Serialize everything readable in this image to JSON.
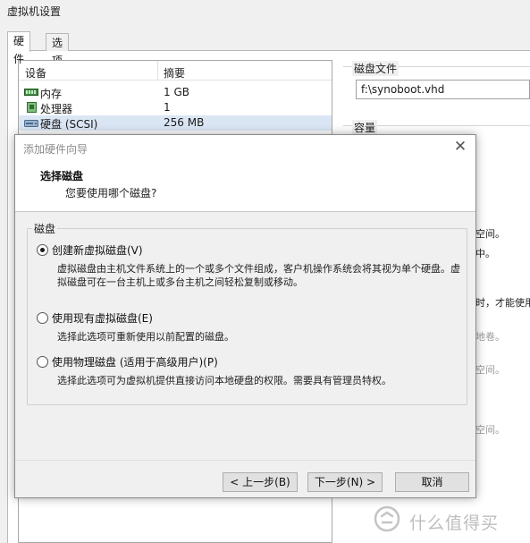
{
  "window": {
    "title": "虚拟机设置",
    "tabs": [
      {
        "label": "硬件",
        "active": true
      },
      {
        "label": "选项",
        "active": false
      }
    ]
  },
  "device_list": {
    "columns": [
      "设备",
      "摘要"
    ],
    "rows": [
      {
        "icon": "memory-icon",
        "name": "内存",
        "summary": "1 GB"
      },
      {
        "icon": "processor-icon",
        "name": "处理器",
        "summary": "1"
      },
      {
        "icon": "hard-disk-icon",
        "name": "硬盘 (SCSI)",
        "summary": "256 MB",
        "selected": true
      }
    ]
  },
  "right_pane": {
    "disk_file_label": "磁盘文件",
    "disk_file_value": "f:\\synoboot.vhd",
    "capacity_label": "容量",
    "fragments": [
      "空间。",
      "中。",
      "时，才能使用",
      "地卷。",
      "空间。",
      "空间。"
    ]
  },
  "dialog": {
    "title": "添加硬件向导",
    "heading": "选择磁盘",
    "subheading": "您要使用哪个磁盘?",
    "group_label": "磁盘",
    "options": [
      {
        "label": "创建新虚拟磁盘(V)",
        "checked": true,
        "description": "虚拟磁盘由主机文件系统上的一个或多个文件组成，客户机操作系统会将其视为单个硬盘。虚拟磁盘可在一台主机上或多台主机之间轻松复制或移动。"
      },
      {
        "label": "使用现有虚拟磁盘(E)",
        "checked": false,
        "description": "选择此选项可重新使用以前配置的磁盘。"
      },
      {
        "label": "使用物理磁盘 (适用于高级用户)(P)",
        "checked": false,
        "description": "选择此选项可为虚拟机提供直接访问本地硬盘的权限。需要具有管理员特权。"
      }
    ],
    "buttons": {
      "back": "< 上一步(B)",
      "next": "下一步(N) >",
      "cancel": "取消"
    }
  },
  "watermark": {
    "text": "什么值得买"
  },
  "colors": {
    "selection": "#dbe6f5",
    "dialog_bg": "#f0f0f0",
    "title_grey": "#8c8c8c"
  }
}
